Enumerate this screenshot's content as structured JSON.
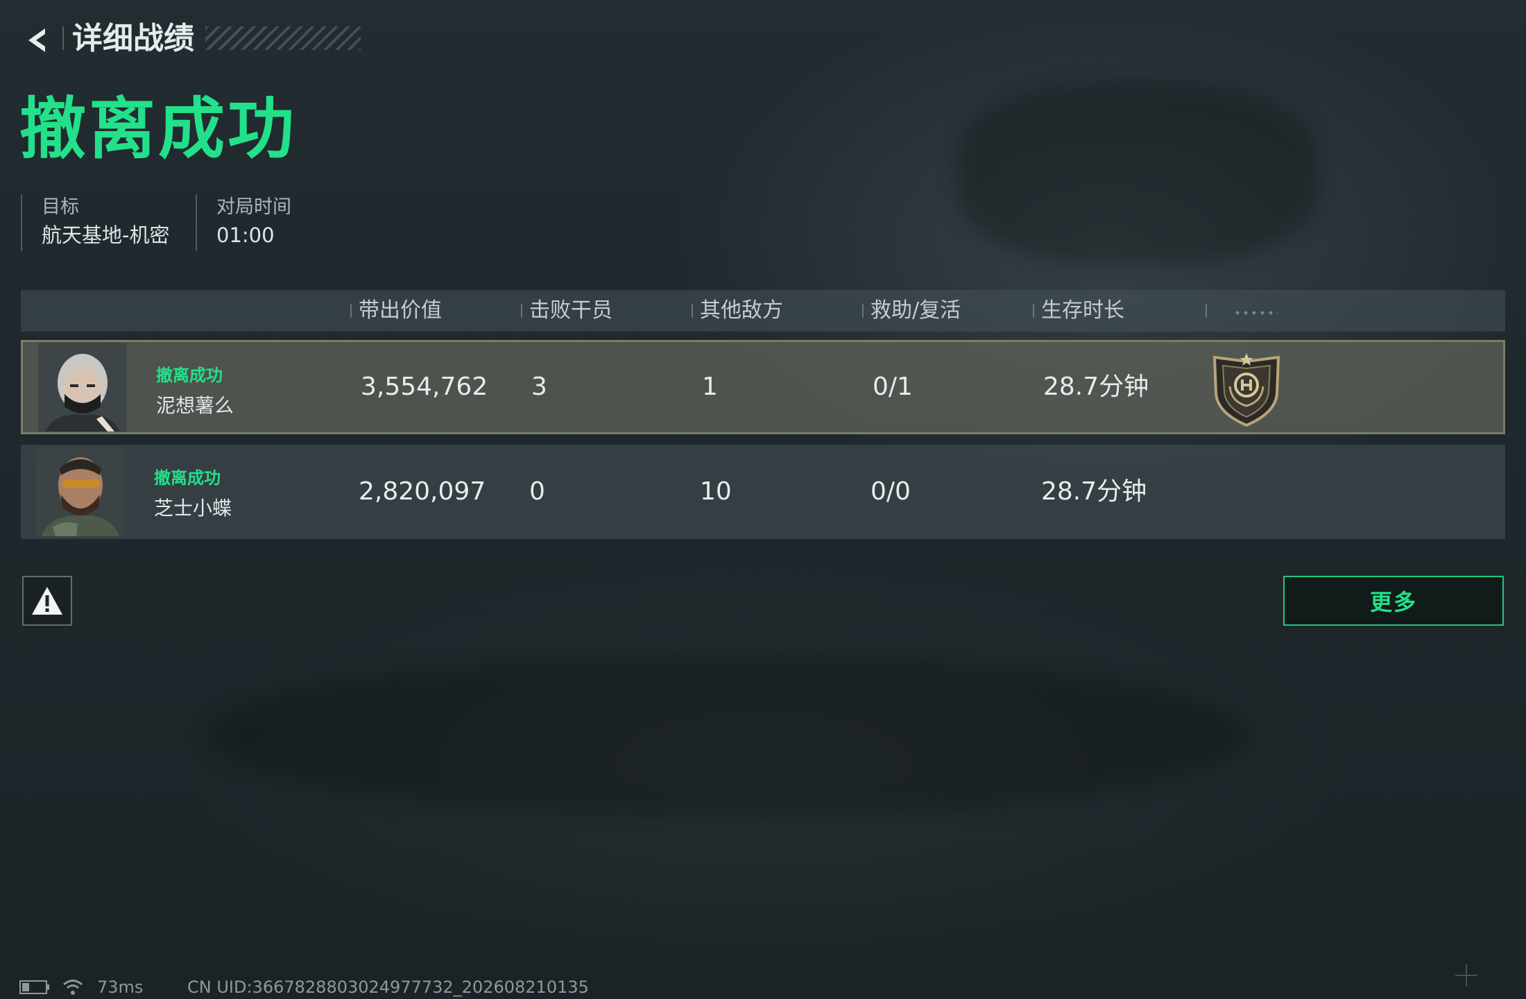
{
  "header": {
    "back_icon": "chevron-left-icon",
    "title": "详细战绩"
  },
  "result": {
    "title": "撤离成功",
    "title_color": "#23e08a"
  },
  "meta": [
    {
      "label": "目标",
      "value": "航天基地-机密"
    },
    {
      "label": "对局时间",
      "value": "01:00"
    }
  ],
  "table": {
    "columns": [
      "带出价值",
      "击败干员",
      "其他敌方",
      "救助/复活",
      "生存时长"
    ],
    "rows": [
      {
        "status": "撤离成功",
        "name": "泥想薯么",
        "value": "3,554,762",
        "kills": "3",
        "other_enemies": "1",
        "assist_revive": "0/1",
        "survival": "28.7分钟",
        "highlighted": true,
        "badge_icon": "mvp-shield-badge-icon"
      },
      {
        "status": "撤离成功",
        "name": "芝士小蝶",
        "value": "2,820,097",
        "kills": "0",
        "other_enemies": "10",
        "assist_revive": "0/0",
        "survival": "28.7分钟",
        "highlighted": false
      }
    ]
  },
  "actions": {
    "report_icon": "warning-icon",
    "more_label": "更多"
  },
  "status_bar": {
    "battery_icon": "battery-icon",
    "wifi_icon": "wifi-icon",
    "ping": "73ms",
    "uid": "CN UID:3667828803024977732_202608210135"
  },
  "colors": {
    "accent_green": "#23e08a",
    "highlight_border": "#7d7c67",
    "background": "#1e272b"
  }
}
